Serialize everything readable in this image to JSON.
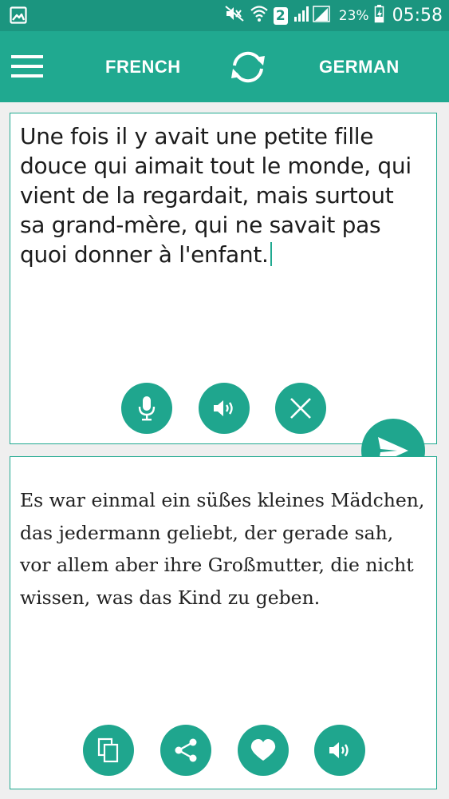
{
  "status_bar": {
    "battery_percent": "23%",
    "sim_slot": "2",
    "clock": "05:58",
    "icons": [
      "gallery-icon",
      "mute-icon",
      "wifi-icon",
      "signal-icon",
      "battery-charging-icon"
    ]
  },
  "app_bar": {
    "source_language": "FRENCH",
    "target_language": "GERMAN",
    "icons": [
      "hamburger-menu-icon",
      "swap-icon"
    ]
  },
  "source": {
    "text": "Une fois il y avait une petite fille douce qui aimait tout le monde, qui vient de la regardait, mais surtout sa grand-mère, qui ne savait pas quoi donner à l'enfant.",
    "actions": [
      "microphone-icon",
      "speaker-icon",
      "clear-icon"
    ]
  },
  "translation": {
    "text": "Es war einmal ein süßes kleines Mädchen, das jedermann geliebt, der gerade sah, vor allem aber ihre Großmutter, die nicht wissen, was das Kind zu geben.",
    "actions": [
      "copy-icon",
      "share-icon",
      "favorite-icon",
      "speaker-icon"
    ]
  },
  "colors": {
    "status_bar": "#1b957f",
    "app_bar": "#20a990",
    "accent": "#1fa68e",
    "background": "#efefef"
  }
}
